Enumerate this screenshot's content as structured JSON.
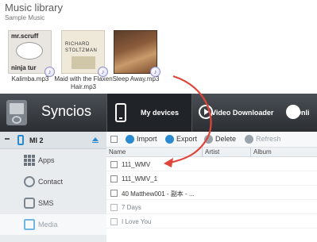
{
  "library": {
    "title": "Music library",
    "subtitle": "Sample Music",
    "albums": [
      {
        "caption": "Kalimba.mp3",
        "cover_text_1": "mr.scruff",
        "cover_text_2": "ninja tur"
      },
      {
        "caption": "Maid with the Flaxen Hair.mp3",
        "cover_text_1": "RICHARD",
        "cover_text_2": "STOLTZMAN"
      },
      {
        "caption": "Sleep Away.mp3"
      }
    ]
  },
  "app": {
    "brand": "Syncios",
    "tabs": {
      "my_devices": "My devices",
      "video_downloader": "Video Downloader",
      "online": "Onli"
    },
    "device": {
      "name": "MI 2"
    },
    "sidebar": [
      {
        "label": "Apps",
        "icon": "apps-icon"
      },
      {
        "label": "Contact",
        "icon": "contact-icon"
      },
      {
        "label": "SMS",
        "icon": "sms-icon"
      },
      {
        "label": "Media",
        "icon": "media-icon"
      }
    ],
    "toolbar": {
      "import": "Import",
      "export": "Export",
      "delete": "Delete",
      "refresh": "Refresh"
    },
    "columns": {
      "name": "Name",
      "artist": "Artist",
      "album": "Album"
    },
    "rows": [
      {
        "name": "111_WMV"
      },
      {
        "name": "111_WMV_1"
      },
      {
        "name": "40 Matthew001 - 副本 - ..."
      },
      {
        "name": "7 Days"
      },
      {
        "name": "I Love You"
      }
    ]
  },
  "colors": {
    "accent": "#2a8ad0",
    "arrow": "#e0453a",
    "topbar": "#2b2f33"
  }
}
